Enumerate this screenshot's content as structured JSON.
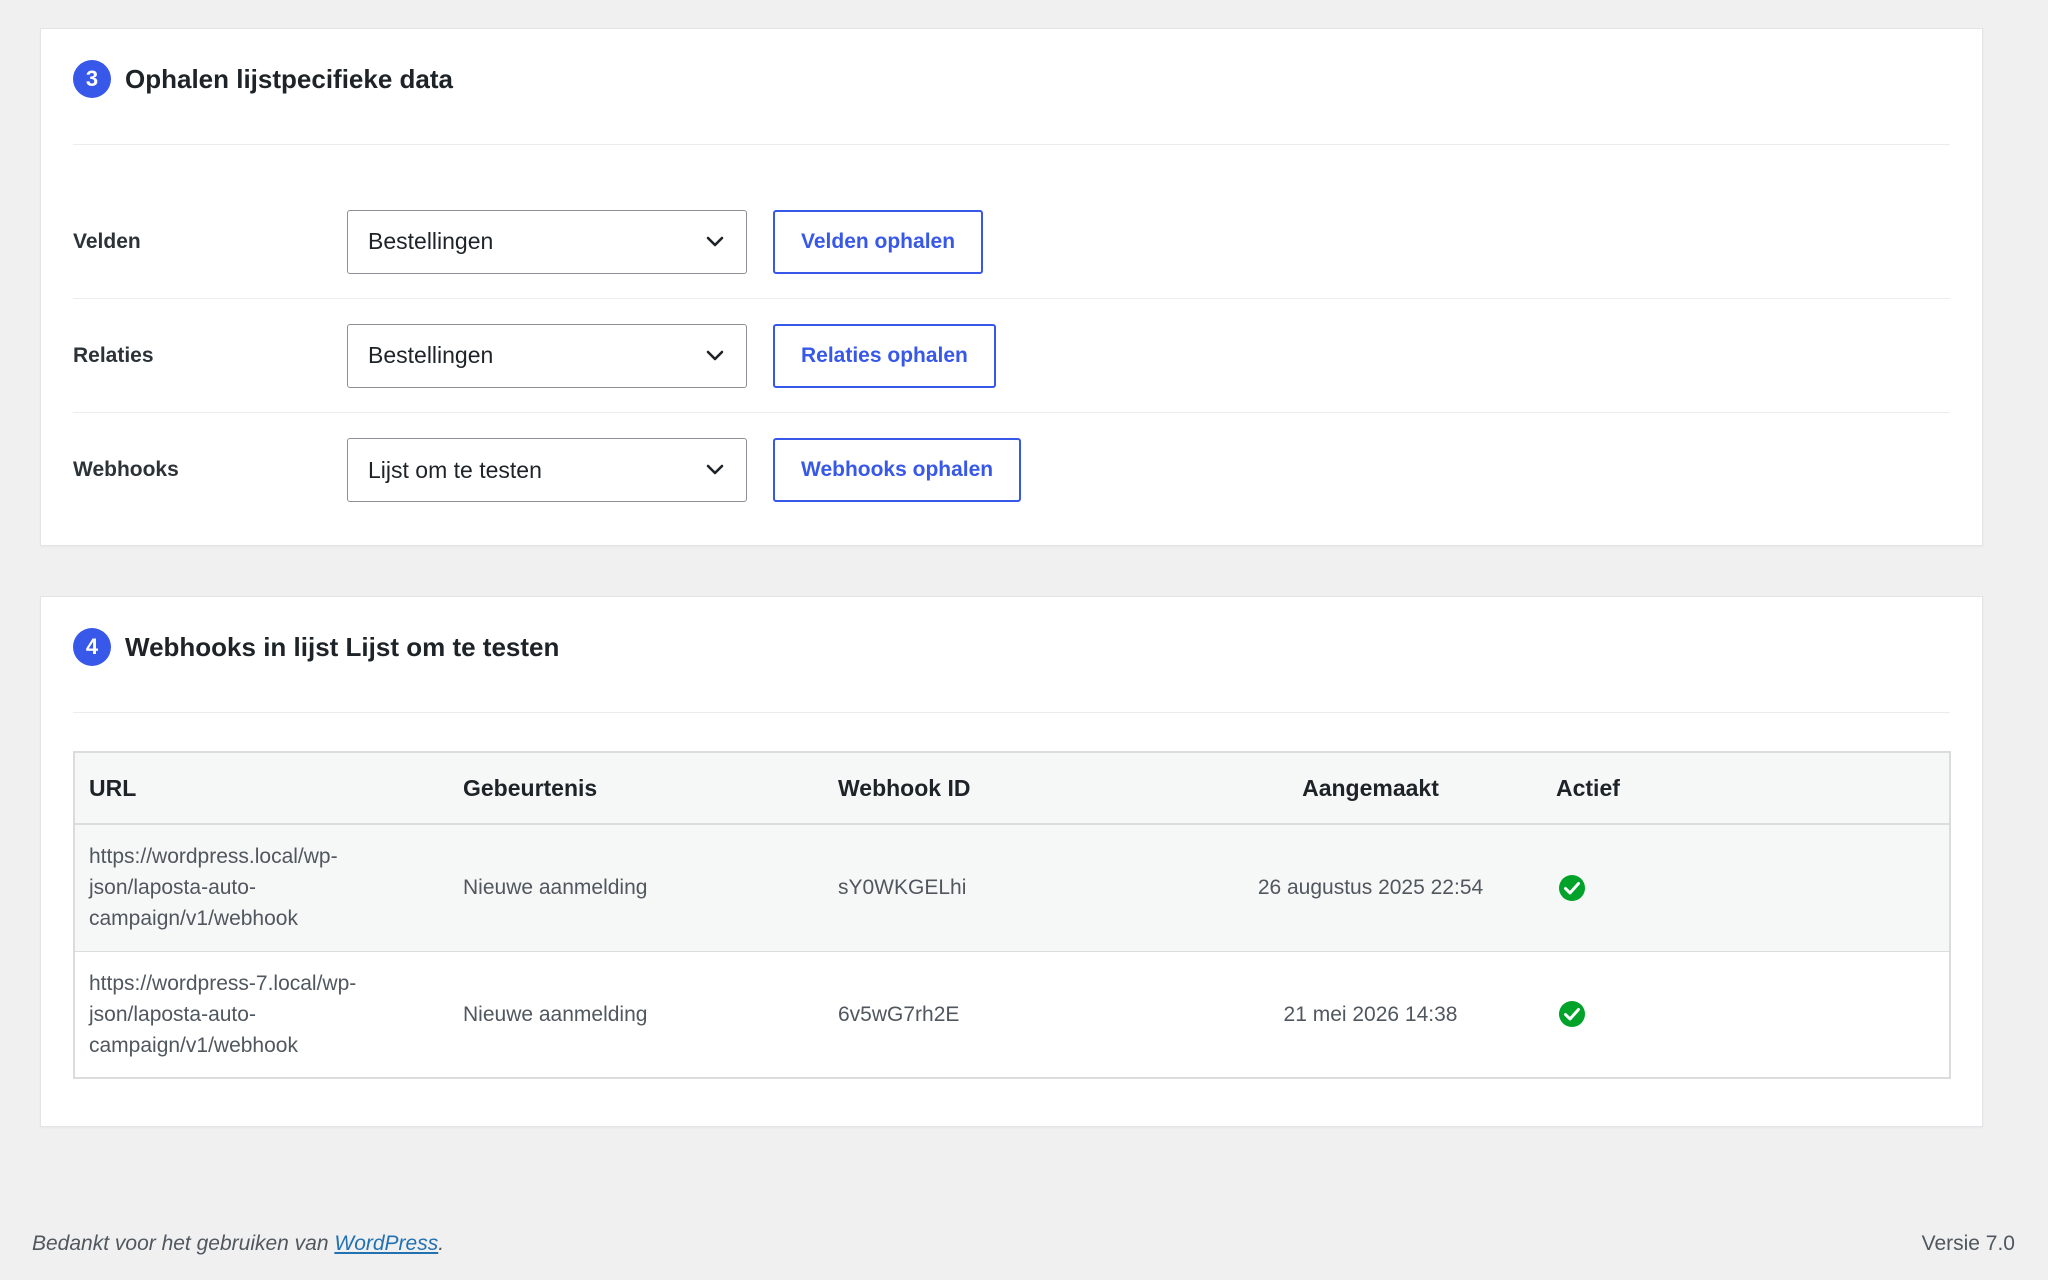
{
  "section3": {
    "step": "3",
    "title": "Ophalen lijstpecifieke data",
    "rows": [
      {
        "label": "Velden",
        "select": "Bestellingen",
        "button": "Velden ophalen"
      },
      {
        "label": "Relaties",
        "select": "Bestellingen",
        "button": "Relaties ophalen"
      },
      {
        "label": "Webhooks",
        "select": "Lijst om te testen",
        "button": "Webhooks ophalen"
      }
    ]
  },
  "section4": {
    "step": "4",
    "title": "Webhooks in lijst Lijst om te testen",
    "table": {
      "headers": [
        "URL",
        "Gebeurtenis",
        "Webhook ID",
        "Aangemaakt",
        "Actief"
      ],
      "rows": [
        {
          "url": "https://wordpress.local/wp-json/laposta-auto-campaign/v1/webhook",
          "event": "Nieuwe aanmelding",
          "id": "sY0WKGELhi",
          "created": "26 augustus 2025 22:54",
          "active_icon": "check-circle-icon"
        },
        {
          "url": "https://wordpress-7.local/wp-json/laposta-auto-campaign/v1/webhook",
          "event": "Nieuwe aanmelding",
          "id": "6v5wG7rh2E",
          "created": "21 mei 2026 14:38",
          "active_icon": "check-circle-icon"
        }
      ]
    }
  },
  "footer": {
    "thanks_prefix": "Bedankt voor het gebruiken van ",
    "link_text": "WordPress",
    "thanks_suffix": ".",
    "version": "Versie 7.0"
  },
  "colors": {
    "accent": "#3858e9",
    "success": "#00a32a",
    "background": "#f0f0f1"
  }
}
